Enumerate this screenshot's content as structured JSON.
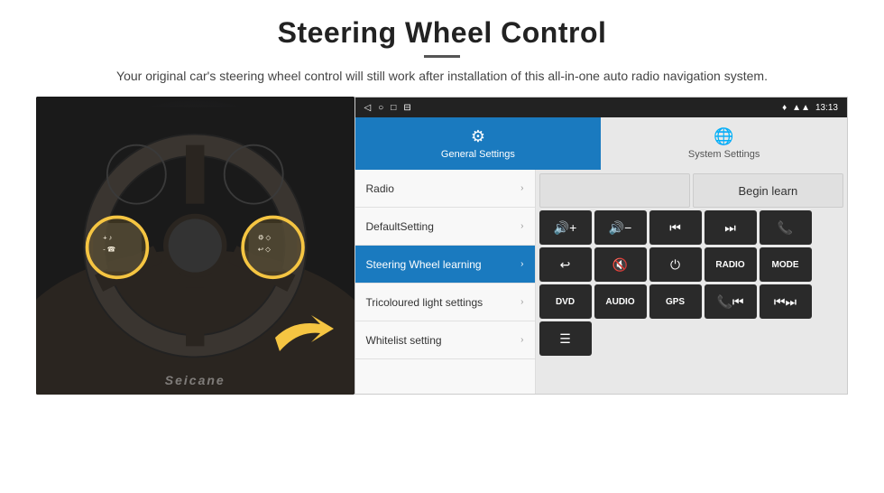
{
  "page": {
    "title": "Steering Wheel Control",
    "subtitle": "Your original car's steering wheel control will still work after installation of this all-in-one auto radio navigation system.",
    "divider": "—"
  },
  "status_bar": {
    "nav_back": "◁",
    "nav_home": "○",
    "nav_square": "□",
    "nav_menu": "⊟",
    "wifi_icon": "wifi",
    "signal_icon": "signal",
    "time": "13:13"
  },
  "tabs": {
    "general_settings": {
      "label": "General Settings",
      "icon": "⚙"
    },
    "system_settings": {
      "label": "System Settings",
      "icon": "🌐"
    }
  },
  "menu_items": [
    {
      "label": "Radio",
      "active": false
    },
    {
      "label": "DefaultSetting",
      "active": false
    },
    {
      "label": "Steering Wheel learning",
      "active": true
    },
    {
      "label": "Tricoloured light settings",
      "active": false
    },
    {
      "label": "Whitelist setting",
      "active": false
    }
  ],
  "right_panel": {
    "begin_learn_label": "Begin learn",
    "control_buttons": [
      [
        "🔊+",
        "🔊-",
        "⏮",
        "⏭",
        "📞"
      ],
      [
        "↩",
        "🔇",
        "⏻",
        "RADIO",
        "MODE"
      ],
      [
        "DVD",
        "AUDIO",
        "GPS",
        "📞⏮",
        "⏮⏭"
      ]
    ],
    "bottom_icon": "≡"
  },
  "watermark": "Seicane"
}
